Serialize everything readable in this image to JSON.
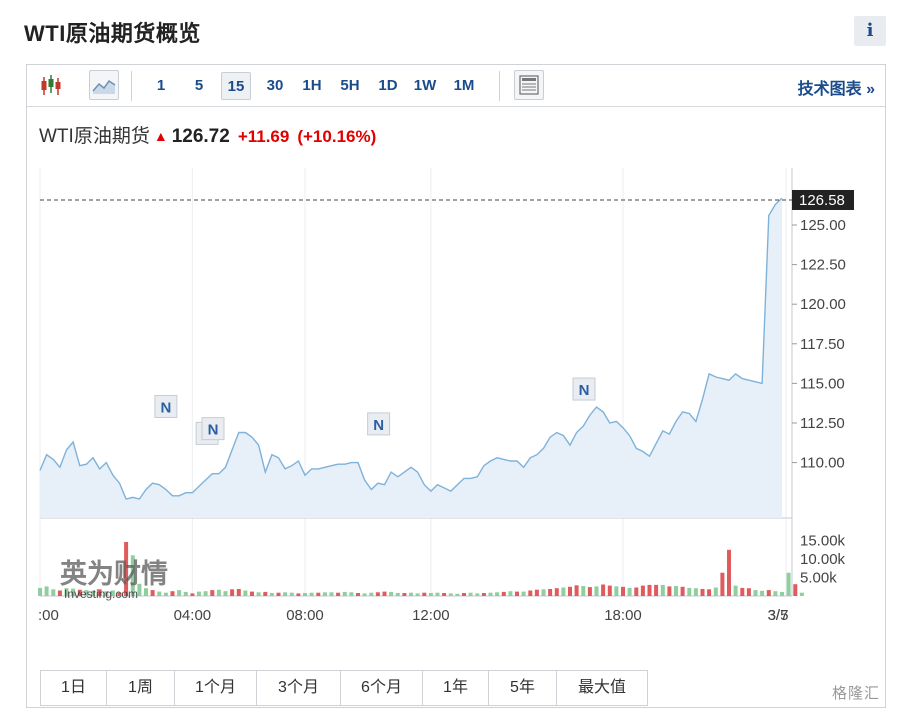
{
  "title": "WTI原油期货概览",
  "info_label": "i",
  "toolbar": {
    "intervals": [
      "1",
      "5",
      "15",
      "30",
      "1H",
      "5H",
      "1D",
      "1W",
      "1M"
    ],
    "active_interval": "15",
    "tech_chart_label": "技术图表 »"
  },
  "quote": {
    "symbol": "WTI原油期货",
    "price": "126.72",
    "change": "+11.69",
    "change_pct": "(+10.16%)",
    "arrow": "▲"
  },
  "ranges": [
    "1日",
    "1周",
    "1个月",
    "3个月",
    "6个月",
    "1年",
    "5年",
    "最大值"
  ],
  "watermarks": {
    "brand": "英为财情",
    "brand_sub": "Investing.com",
    "corner": "格隆汇"
  },
  "colors": {
    "line": "#7fb2d9",
    "area": "#e7f0f8",
    "up": "#e05b5b",
    "down": "#8fcf9f",
    "link": "#1a4c8c",
    "change": "#e00000"
  },
  "chart_data": {
    "type": "area",
    "price": {
      "x": [
        0,
        1,
        2,
        3,
        4,
        5,
        6,
        7,
        8,
        9,
        10,
        11,
        12,
        13,
        14,
        15,
        16,
        17,
        18,
        19,
        20,
        21,
        22,
        23,
        24,
        25,
        26,
        27,
        28,
        29,
        30,
        31,
        32,
        33,
        34,
        35,
        36,
        37,
        38,
        39,
        40,
        41,
        42,
        43,
        44,
        45,
        46,
        47,
        48,
        49,
        50,
        51,
        52,
        53,
        54,
        55,
        56,
        57,
        58,
        59,
        60,
        61,
        62,
        63,
        64,
        65,
        66,
        67,
        68,
        69,
        70,
        71,
        72,
        73,
        74,
        75,
        76,
        77,
        78,
        79,
        80,
        81,
        82,
        83,
        84,
        85,
        86,
        87,
        88,
        89,
        90,
        91,
        92,
        93,
        94,
        95,
        96,
        97,
        98,
        99,
        100,
        101,
        102,
        103,
        104,
        105,
        106,
        107,
        108,
        109,
        110,
        111,
        112,
        113,
        114,
        115,
        116,
        117,
        118,
        119,
        120,
        121,
        122,
        123,
        124,
        125,
        126,
        127,
        128,
        129
      ],
      "values": [
        109.5,
        110.5,
        110.2,
        109.7,
        110.8,
        111.3,
        109.8,
        109.9,
        110.3,
        109.6,
        110.0,
        109.2,
        108.7,
        107.7,
        107.8,
        107.7,
        108.3,
        108.7,
        108.6,
        108.3,
        107.9,
        107.9,
        108.1,
        108.1,
        108.5,
        108.9,
        109.3,
        109.3,
        109.7,
        110.8,
        111.9,
        111.9,
        111.6,
        111.1,
        109.4,
        110.5,
        110.3,
        109.6,
        109.8,
        110.1,
        109.2,
        109.6,
        109.6,
        109.7,
        109.8,
        109.9,
        109.9,
        110.0,
        110.0,
        108.9,
        108.3,
        108.7,
        108.6,
        109.4,
        109.1,
        109.4,
        109.7,
        109.4,
        108.6,
        108.2,
        108.6,
        108.4,
        108.2,
        108.6,
        109.0,
        109.0,
        109.1,
        109.8,
        110.1,
        110.3,
        110.2,
        110.1,
        110.1,
        109.7,
        110.3,
        110.5,
        110.9,
        111.6,
        111.9,
        111.7,
        111.1,
        111.9,
        112.3,
        113.0,
        113.5,
        113.2,
        112.5,
        112.6,
        112.2,
        111.7,
        110.9,
        110.7,
        110.4,
        111.2,
        112.0,
        111.8,
        112.6,
        113.2,
        113.1,
        112.6,
        114.0,
        115.6,
        115.4,
        115.3,
        115.2,
        115.6,
        115.3,
        115.2,
        115.1,
        115.0,
        125.6,
        126.3,
        126.7
      ],
      "last": 126.58,
      "reference_line": 126.58
    },
    "y_ticks": [
      "125.00",
      "122.50",
      "120.00",
      "117.50",
      "115.00",
      "112.50",
      "110.00"
    ],
    "y_tick_values": [
      125.0,
      122.5,
      120.0,
      117.5,
      115.0,
      112.5,
      110.0
    ],
    "ylim": [
      106.5,
      128.6
    ],
    "x_ticks": [
      ":00",
      "04:00",
      "08:00",
      "12:00",
      "18:00",
      "3/5",
      "3/7"
    ],
    "x_tick_index": [
      0,
      23,
      40,
      59,
      88,
      116,
      138
    ],
    "volume": {
      "y_ticks": [
        "15.00k",
        "10.00k",
        "5.00k"
      ],
      "y_tick_values": [
        15000,
        10000,
        5000
      ],
      "ylim": [
        0,
        16500
      ],
      "values": [
        2200,
        2600,
        1800,
        1500,
        2100,
        2000,
        1700,
        1600,
        1400,
        1800,
        1300,
        1500,
        900,
        14600,
        11000,
        3300,
        2100,
        1600,
        1200,
        900,
        1300,
        1600,
        1100,
        700,
        1200,
        1300,
        1600,
        1700,
        1300,
        1800,
        1900,
        1500,
        1200,
        1000,
        1100,
        800,
        900,
        1000,
        900,
        700,
        800,
        900,
        900,
        1000,
        1000,
        900,
        1100,
        1000,
        800,
        700,
        900,
        1000,
        1200,
        1100,
        800,
        800,
        900,
        700,
        900,
        800,
        900,
        800,
        700,
        600,
        800,
        900,
        700,
        800,
        900,
        1000,
        1100,
        1300,
        1200,
        1200,
        1500,
        1700,
        1800,
        1900,
        2100,
        2300,
        2500,
        2900,
        2700,
        2400,
        2600,
        3100,
        2800,
        2600,
        2500,
        2200,
        2300,
        2800,
        3000,
        3000,
        3000,
        2600,
        2700,
        2500,
        2200,
        2100,
        1900,
        1800,
        2300,
        6300,
        12500,
        2800,
        2200,
        2100,
        1600,
        1400,
        1600,
        1300,
        1100,
        6300,
        3200,
        900
      ],
      "direction": [
        "d",
        "d",
        "d",
        "u",
        "d",
        "d",
        "u",
        "d",
        "d",
        "u",
        "d",
        "d",
        "u",
        "u",
        "d",
        "d",
        "d",
        "u",
        "d",
        "d",
        "u",
        "d",
        "d",
        "u",
        "d",
        "d",
        "u",
        "d",
        "d",
        "u",
        "u",
        "d",
        "u",
        "d",
        "u",
        "d",
        "u",
        "d",
        "d",
        "u",
        "d",
        "d",
        "u",
        "d",
        "d",
        "u",
        "d",
        "d",
        "u",
        "d",
        "d",
        "u",
        "u",
        "d",
        "d",
        "u",
        "d",
        "d",
        "u",
        "d",
        "d",
        "u",
        "d",
        "d",
        "u",
        "d",
        "d",
        "u",
        "d",
        "d",
        "u",
        "d",
        "u",
        "d",
        "u",
        "u",
        "d",
        "u",
        "u",
        "d",
        "u",
        "u",
        "d",
        "u",
        "d",
        "u",
        "u",
        "d",
        "u",
        "d",
        "u",
        "u",
        "u",
        "u",
        "d",
        "u",
        "d",
        "u",
        "d",
        "d",
        "u",
        "u",
        "d",
        "u",
        "u",
        "d",
        "u",
        "u",
        "d",
        "d",
        "u",
        "d",
        "d",
        "d",
        "u"
      ]
    },
    "news_markers": [
      "N",
      "N",
      "N",
      "N",
      "N"
    ]
  }
}
